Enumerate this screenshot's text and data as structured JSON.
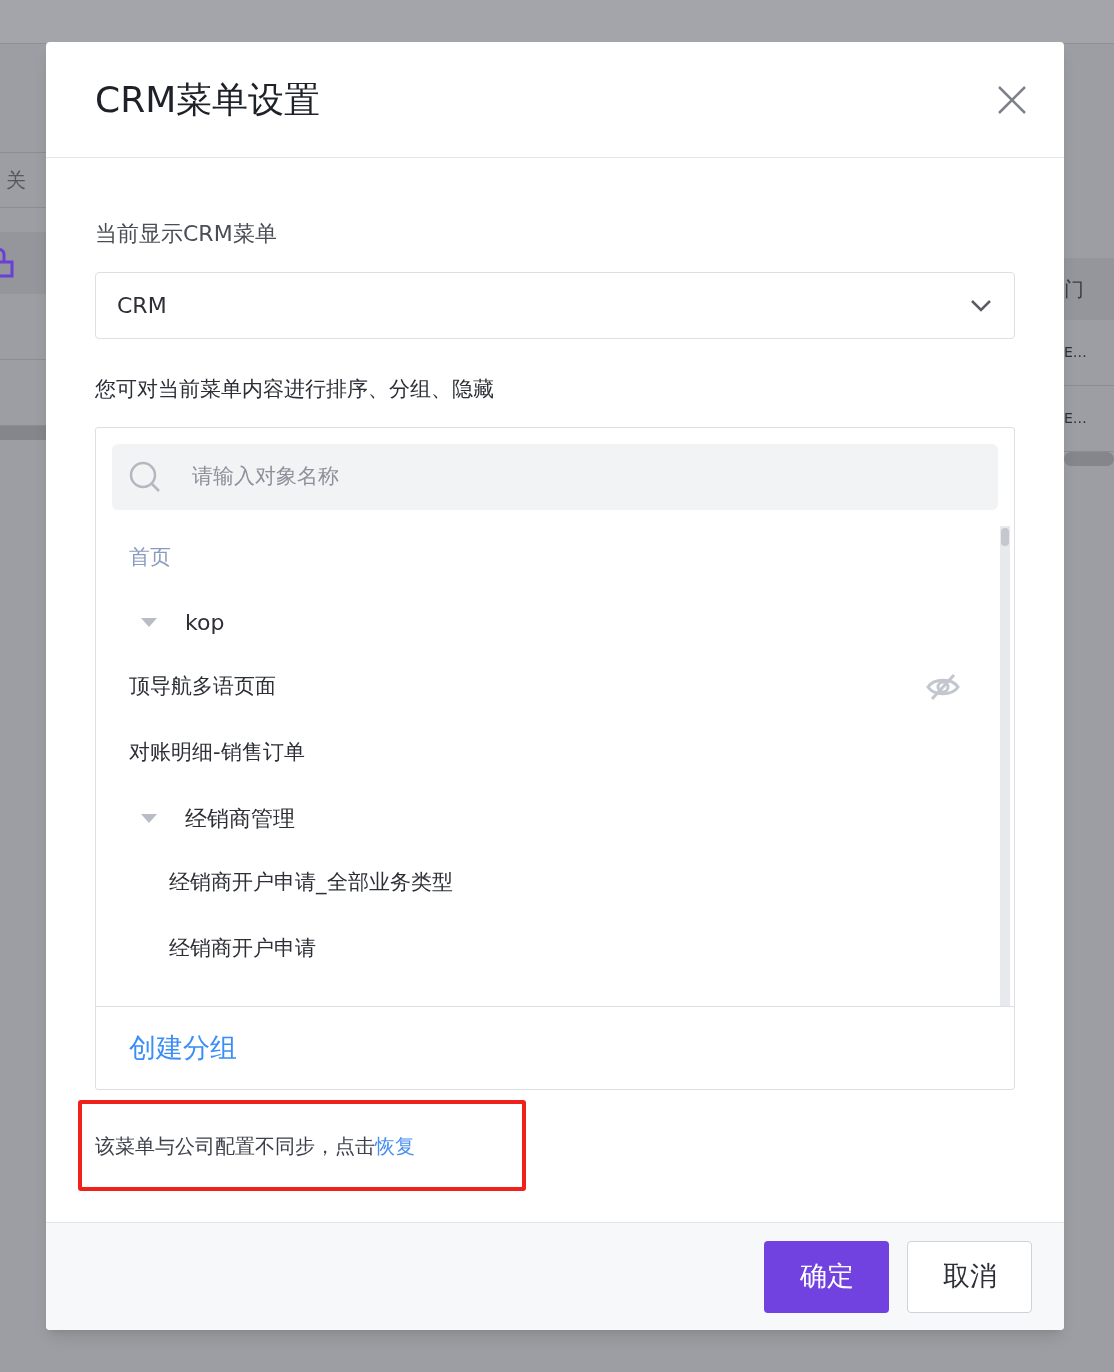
{
  "background": {
    "search_fragment": "关",
    "header_fragment": "门",
    "row_fragments": [
      "E…",
      "E…"
    ]
  },
  "dialog": {
    "title": "CRM菜单设置",
    "menu_label": "当前显示CRM菜单",
    "menu_select": {
      "value": "CRM"
    },
    "hint": "您可对当前菜单内容进行排序、分组、隐藏",
    "search": {
      "placeholder": "请输入对象名称"
    },
    "tree": [
      {
        "kind": "section",
        "label": "首页"
      },
      {
        "kind": "folder",
        "label": "kop",
        "expanded": true
      },
      {
        "kind": "page",
        "label": "顶导航多语页面",
        "hidden": true
      },
      {
        "kind": "page",
        "label": "对账明细-销售订单",
        "hidden": false
      },
      {
        "kind": "folder",
        "label": "经销商管理",
        "expanded": true,
        "children": [
          {
            "kind": "page",
            "label": "经销商开户申请_全部业务类型",
            "hidden": false
          },
          {
            "kind": "page",
            "label": "经销商开户申请",
            "hidden": false
          }
        ]
      }
    ],
    "create_group": "创建分组",
    "sync_note": "该菜单与公司配置不同步，点击",
    "restore_link": "恢复",
    "buttons": [
      {
        "label": "确定",
        "kind": "primary"
      },
      {
        "label": "取消",
        "kind": "default"
      }
    ]
  }
}
